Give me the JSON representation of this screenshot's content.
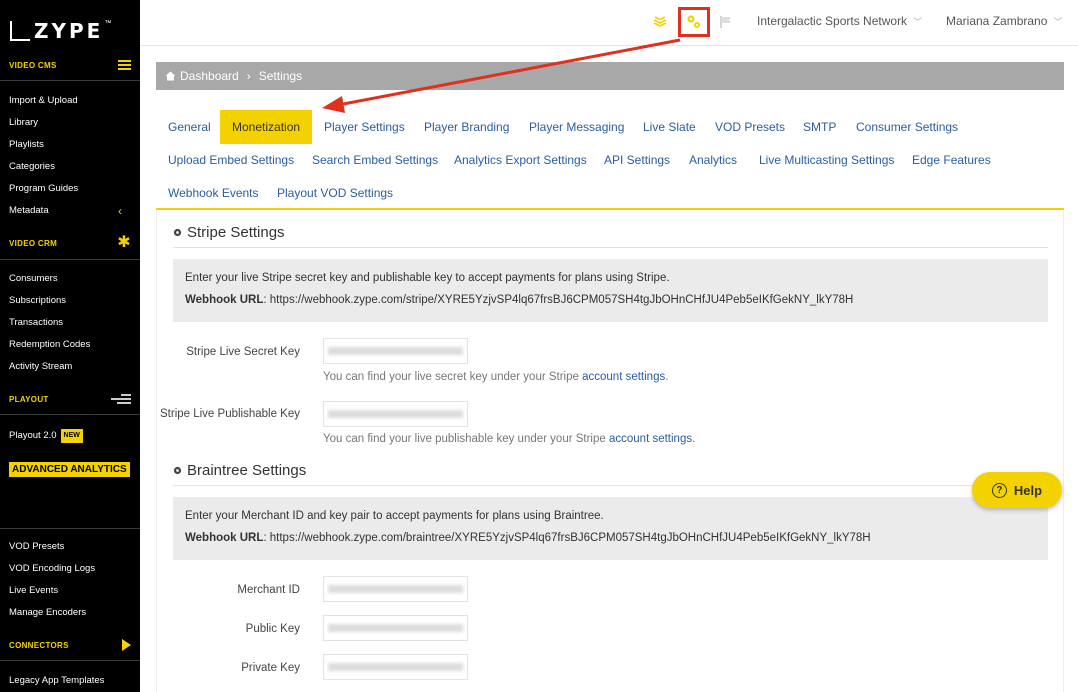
{
  "logo": {
    "word": "ZYPE",
    "tm": "™"
  },
  "sidebar": {
    "sections": {
      "video_cms": "VIDEO CMS",
      "video_crm": "VIDEO CRM",
      "playout": "PLAYOUT",
      "connectors": "CONNECTORS"
    },
    "cms_items": [
      "Import & Upload",
      "Library",
      "Playlists",
      "Categories",
      "Program Guides",
      "Metadata"
    ],
    "crm_items": [
      "Consumers",
      "Subscriptions",
      "Transactions",
      "Redemption Codes",
      "Activity Stream"
    ],
    "playout_item": "Playout 2.0",
    "new_badge": "NEW",
    "advanced_analytics": "ADVANCED ANALYTICS",
    "bottom_items": [
      "VOD Presets",
      "VOD Encoding Logs",
      "Live Events",
      "Manage Encoders"
    ],
    "connector_items": [
      "Legacy App Templates"
    ]
  },
  "topbar": {
    "network": "Intergalactic Sports Network",
    "user": "Mariana Zambrano"
  },
  "breadcrumb": {
    "home": "Dashboard",
    "separator": "›",
    "current": "Settings"
  },
  "tabs": [
    "General",
    "Monetization",
    "Player Settings",
    "Player Branding",
    "Player Messaging",
    "Live Slate",
    "VOD Presets",
    "SMTP",
    "Consumer Settings",
    "Upload Embed Settings",
    "Search Embed Settings",
    "Analytics Export Settings",
    "API Settings",
    "Analytics",
    "Live Multicasting Settings",
    "Edge Features",
    "Webhook Events",
    "Playout VOD Settings"
  ],
  "active_tab": "Monetization",
  "stripe": {
    "title": "Stripe Settings",
    "description": "Enter your live Stripe secret key and publishable key to accept payments for plans using Stripe.",
    "webhook_label": "Webhook URL",
    "webhook_url": ": https://webhook.zype.com/stripe/XYRE5YzjvSP4lq67frsBJ6CPM057SH4tgJbOHnCHfJU4Peb5eIKfGekNY_lkY78H",
    "secret_label": "Stripe Live Secret Key",
    "secret_hint": "You can find your live secret key under your Stripe ",
    "secret_hint_link": "account settings",
    "publishable_label": "Stripe Live Publishable Key",
    "publishable_hint": "You can find your live publishable key under your Stripe ",
    "publishable_hint_link": "account settings",
    "period": "."
  },
  "braintree": {
    "title": "Braintree Settings",
    "description": "Enter your Merchant ID and key pair to accept payments for plans using Braintree.",
    "webhook_label": "Webhook URL",
    "webhook_url": ": https://webhook.zype.com/braintree/XYRE5YzjvSP4lq67frsBJ6CPM057SH4tgJbOHnCHfJU4Peb5eIKfGekNY_lkY78H",
    "merchant_label": "Merchant ID",
    "public_label": "Public Key",
    "private_label": "Private Key"
  },
  "help": {
    "label": "Help",
    "glyph": "?"
  },
  "colors": {
    "accent": "#f4d200",
    "link": "#2a5d9f",
    "annotation": "#e0301e"
  }
}
